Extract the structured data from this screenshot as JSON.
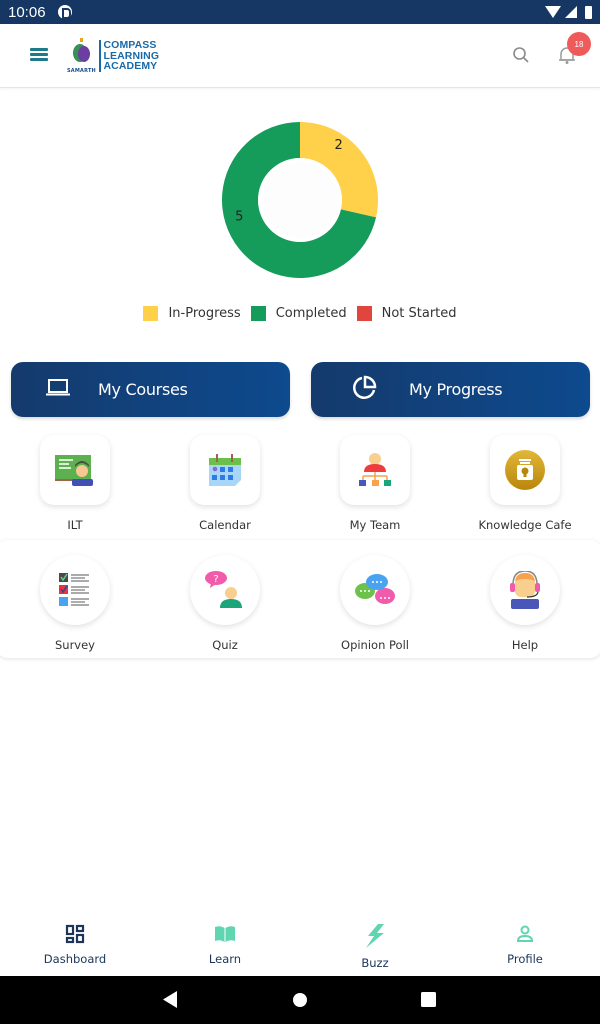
{
  "status_bar": {
    "time": "10:06",
    "icons": [
      "app-notification-icon",
      "wifi-icon",
      "signal-icon",
      "battery-icon"
    ]
  },
  "app_bar": {
    "menu_icon": "hamburger-menu-icon",
    "logo": {
      "brand_line1": "COMPASS",
      "brand_line2": "LEARNING",
      "brand_line3": "ACADEMY",
      "sub": "SAMARTH"
    },
    "search_icon": "search-icon",
    "notification_icon": "bell-icon",
    "notification_count": "18"
  },
  "chart_data": {
    "type": "pie",
    "variant": "donut",
    "title": "",
    "categories": [
      "In-Progress",
      "Completed",
      "Not Started"
    ],
    "values": [
      2,
      5,
      0
    ],
    "data_labels": [
      "2",
      "5",
      ""
    ],
    "colors": [
      "#ffd04a",
      "#169c5a",
      "#e0453e"
    ],
    "legend_position": "bottom"
  },
  "actions": {
    "my_courses": {
      "label": "My Courses",
      "icon": "laptop-icon"
    },
    "my_progress": {
      "label": "My Progress",
      "icon": "pie-chart-icon"
    }
  },
  "tiles": [
    {
      "label": "ILT",
      "icon": "classroom-teacher-icon"
    },
    {
      "label": "Calendar",
      "icon": "calendar-icon"
    },
    {
      "label": "My Team",
      "icon": "team-hierarchy-icon"
    },
    {
      "label": "Knowledge Cafe",
      "icon": "knowledge-jar-icon"
    },
    {
      "label": "Survey",
      "icon": "checklist-icon"
    },
    {
      "label": "Quiz",
      "icon": "question-person-icon"
    },
    {
      "label": "Opinion Poll",
      "icon": "chat-bubbles-icon"
    },
    {
      "label": "Help",
      "icon": "headset-support-icon"
    }
  ],
  "bottom_nav": [
    {
      "label": "Dashboard",
      "icon": "dashboard-grid-icon",
      "active": true
    },
    {
      "label": "Learn",
      "icon": "book-icon",
      "active": false
    },
    {
      "label": "Buzz",
      "icon": "lightning-icon",
      "active": false
    },
    {
      "label": "Profile",
      "icon": "person-icon",
      "active": false
    }
  ],
  "system_nav": [
    "back-button",
    "home-button",
    "recents-button"
  ]
}
